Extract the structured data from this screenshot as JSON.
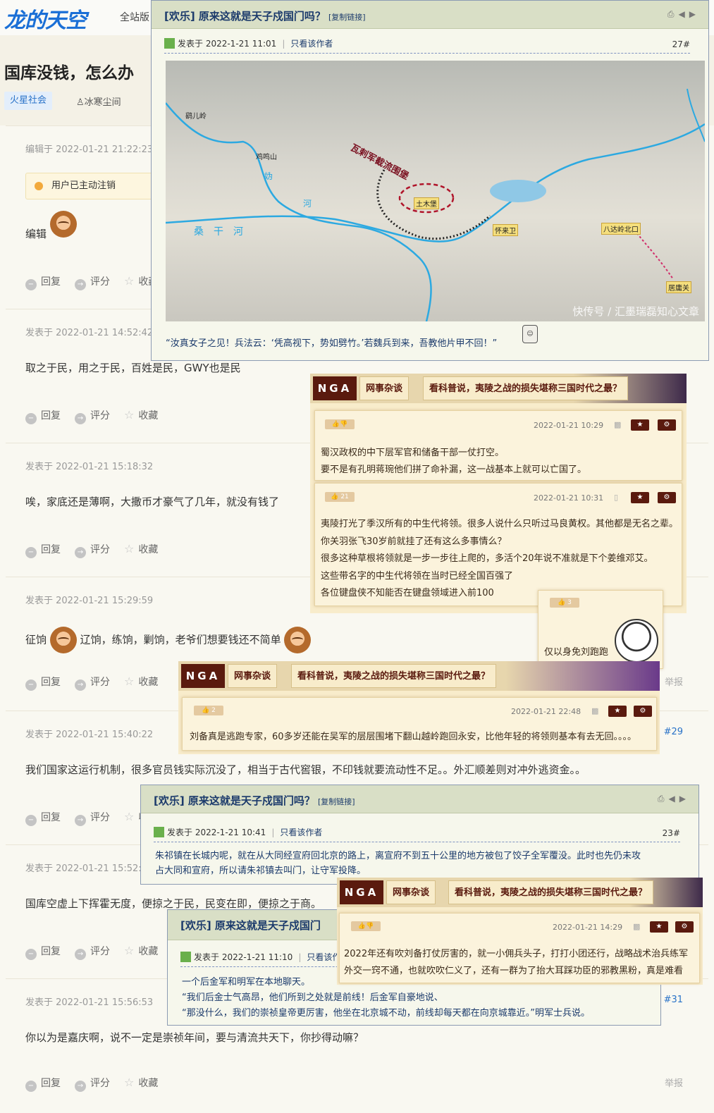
{
  "header": {
    "logo": "龙的天空",
    "nav_all": "全站版"
  },
  "thread": {
    "title": "国库没钱，怎么办",
    "tag": "火星社会",
    "author": "冰寒尘间",
    "author_icon": "user-icon"
  },
  "actions": {
    "reply": "回复",
    "rate": "评分",
    "fav": "收藏",
    "report": "举报"
  },
  "posts": [
    {
      "time": "编辑于 2022-01-21 21:22:23",
      "notice": "用户已主动注销",
      "content": "编辑"
    },
    {
      "time": "发表于 2022-01-21 14:52:42",
      "content": "取之于民，用之于民，百姓是民，GWY也是民"
    },
    {
      "time": "发表于 2022-01-21 15:18:32",
      "content": "唉，家底还是薄啊，大撒币才豪气了几年，就没有钱了"
    },
    {
      "time": "发表于 2022-01-21 15:29:59",
      "content_a": "征饷",
      "content_b": "辽饷，练饷，剿饷，老爷们想要钱还不简单"
    },
    {
      "time": "发表于 2022-01-21 15:40:22",
      "floor": "#29",
      "content": "我们国家这运行机制，很多官员钱实际沉没了，相当于古代窖银，不印钱就要流动性不足。。外汇顺差则对冲外逃资金。。"
    },
    {
      "time": "发表于 2022-01-21 15:52:1",
      "content": "国库空虚上下挥霍无度，便掠之于民，民变在即，便掠之于商。"
    },
    {
      "time": "发表于 2022-01-21 15:56:53",
      "floor": "#31",
      "content": "你以为是嘉庆啊，说不一定是崇祯年间，要与清流共天下，你抄得动嘛？"
    }
  ],
  "overlay_bbs_1": {
    "title": "[欢乐] 原来这就是天子戍国门吗？",
    "copy": "[复制链接]",
    "time": "发表于 2022-1-21 11:01",
    "only_author": "只看该作者",
    "floor": "27#",
    "map_labels": {
      "a": "鹞儿岭",
      "b": "鸡鸣山",
      "c": "土木堡",
      "d": "怀来卫",
      "e": "八达岭北口",
      "f": "居庸关",
      "g": "瓦剌军截流围堡",
      "h": "妫",
      "i": "桑干河",
      "j": "河"
    },
    "watermark": "快传号 / 汇墨瑞磊知心文章",
    "text": "“汝真女子之见！兵法云：‘凭高视下，势如劈竹。’若魏兵到来，吾教他片甲不回！”",
    "face_icon": "face-icon"
  },
  "overlay_nga_1": {
    "logo": "NGA",
    "tab1": "网事杂谈",
    "tab2": "看科普说，夷陵之战的损失堪称三国时代之最？",
    "c1": {
      "time": "2022-01-21 10:29",
      "lines": [
        "蜀汉政权的中下层军官和储备干部一仗打空。",
        "要不是有孔明蒋琬他们拼了命补漏，这一战基本上就可以亡国了。"
      ]
    },
    "c2": {
      "likes": "21",
      "time": "2022-01-21 10:31",
      "lines": [
        "夷陵打光了季汉所有的中生代将领。很多人说什么只听过马良黄权。其他都是无名之辈。",
        "你关羽张飞30岁前就挂了还有这么多事情么？",
        "很多这种草根将领就是一步一步往上爬的，多活个20年说不准就是下个姜维邓艾。",
        "这些带名字的中生代将领在当时已经全国百强了",
        "各位键盘侠不知能否在键盘领域进入前100"
      ]
    },
    "c3": {
      "likes": "3",
      "text": "仅以身免刘跑跑"
    }
  },
  "overlay_nga_2": {
    "logo": "NGA",
    "tab1": "网事杂谈",
    "tab2": "看科普说，夷陵之战的损失堪称三国时代之最？",
    "likes": "2",
    "time": "2022-01-21 22:48",
    "text": "刘备真是逃跑专家，60多岁还能在吴军的层层围堵下翻山越岭跑回永安，比他年轻的将领则基本有去无回。。。。"
  },
  "overlay_bbs_2": {
    "title": "[欢乐] 原来这就是天子戍国门吗？",
    "copy": "[复制链接]",
    "time": "发表于 2022-1-21 10:41",
    "only_author": "只看该作者",
    "floor": "23#",
    "line1": "朱祁镇在长城内呢，就在从大同经宣府回北京的路上，离宣府不到五十公里的地方被包了饺子全军覆没。此时也先仍未攻",
    "line2": "占大同和宣府，所以请朱祁镇去叫门，让守军投降。"
  },
  "overlay_nga_3": {
    "logo": "NGA",
    "tab1": "网事杂谈",
    "tab2": "看科普说，夷陵之战的损失堪称三国时代之最？",
    "time": "2022-01-21 14:29",
    "line1": "2022年还有吹刘备打仗厉害的，就一小佣兵头子，打打小团还行，战略战术治兵练军",
    "line2": "外交一窍不通，也就吹吹仁义了，还有一群为了抬大耳踩功臣的邪教黑粉，真是难看"
  },
  "overlay_bbs_3": {
    "title": "[欢乐] 原来这就是天子戍国门",
    "time": "发表于 2022-1-21 11:10",
    "only_author": "只看该作",
    "line1": "一个后金军和明军在本地聊天。",
    "line2": "“我们后金士气高昂，他们所到之处就是前线！后金军自豪地说、",
    "line3": "“那没什么，我们的崇祯皇帝更厉害，他坐在北京城不动，前线却每天都在向京城靠近。”明军士兵说。"
  },
  "colors": {
    "brand": "#1a6fd6",
    "bbs_title": "#1b3a6b",
    "nga_dark": "#5a1a0e",
    "nga_bg": "#f8eccb"
  }
}
